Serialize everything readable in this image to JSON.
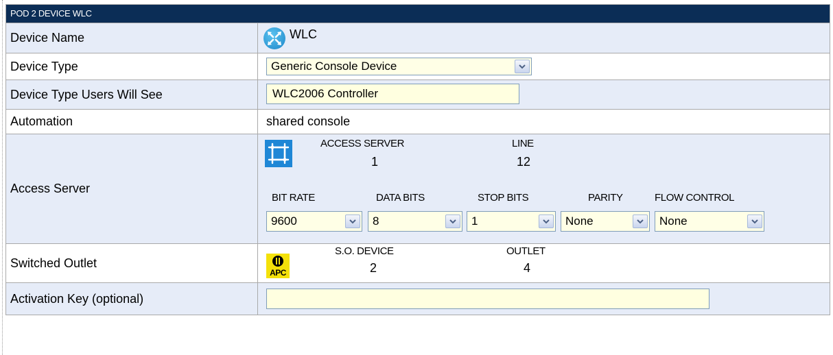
{
  "header": {
    "title": "POD 2 DEVICE WLC"
  },
  "rows": {
    "device_name": {
      "label": "Device Name",
      "value": "WLC",
      "icon": "wireless-controller-icon"
    },
    "device_type": {
      "label": "Device Type",
      "selected": "Generic Console Device"
    },
    "device_type_users": {
      "label": "Device Type Users Will See",
      "value": "WLC2006 Controller"
    },
    "automation": {
      "label": "Automation",
      "value": "shared console"
    },
    "access_server": {
      "label": "Access Server",
      "icon": "access-server-icon",
      "server_header": "ACCESS SERVER",
      "server_value": "1",
      "line_header": "LINE",
      "line_value": "12",
      "bit_rate": {
        "header": "BIT RATE",
        "selected": "9600"
      },
      "data_bits": {
        "header": "DATA BITS",
        "selected": "8"
      },
      "stop_bits": {
        "header": "STOP BITS",
        "selected": "1"
      },
      "parity": {
        "header": "PARITY",
        "selected": "None"
      },
      "flow_control": {
        "header": "FLOW CONTROL",
        "selected": "None"
      }
    },
    "switched_outlet": {
      "label": "Switched Outlet",
      "icon": "apc-power-icon",
      "icon_text": "APC",
      "device_header": "S.O. DEVICE",
      "device_value": "2",
      "outlet_header": "OUTLET",
      "outlet_value": "4"
    },
    "activation_key": {
      "label": "Activation Key (optional)",
      "value": ""
    }
  },
  "colors": {
    "header_bg": "#0b2d56",
    "alt_row_bg": "#e6ecf8",
    "input_bg": "#ffffe0",
    "border": "#a9a9a9"
  }
}
